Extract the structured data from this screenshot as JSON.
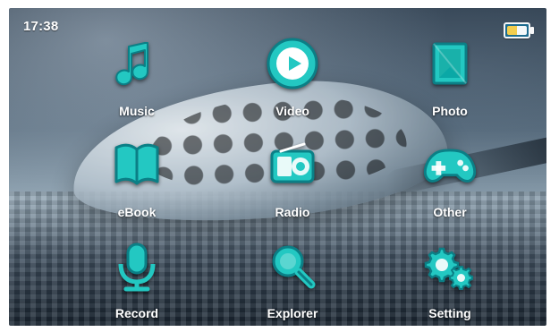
{
  "status_bar": {
    "time": "17:38",
    "battery_icon": "battery-icon"
  },
  "menu": {
    "items": [
      {
        "label": "Music",
        "icon": "music-note-icon"
      },
      {
        "label": "Video",
        "icon": "play-icon"
      },
      {
        "label": "Photo",
        "icon": "photo-icon"
      },
      {
        "label": "eBook",
        "icon": "book-icon"
      },
      {
        "label": "Radio",
        "icon": "radio-icon"
      },
      {
        "label": "Other",
        "icon": "gamepad-icon"
      },
      {
        "label": "Record",
        "icon": "microphone-icon"
      },
      {
        "label": "Explorer",
        "icon": "magnifier-icon"
      },
      {
        "label": "Setting",
        "icon": "gears-icon"
      }
    ]
  },
  "colors": {
    "icon_primary": "#23c8c2",
    "icon_secondary": "#0aa8a6",
    "label": "#ffffff"
  }
}
